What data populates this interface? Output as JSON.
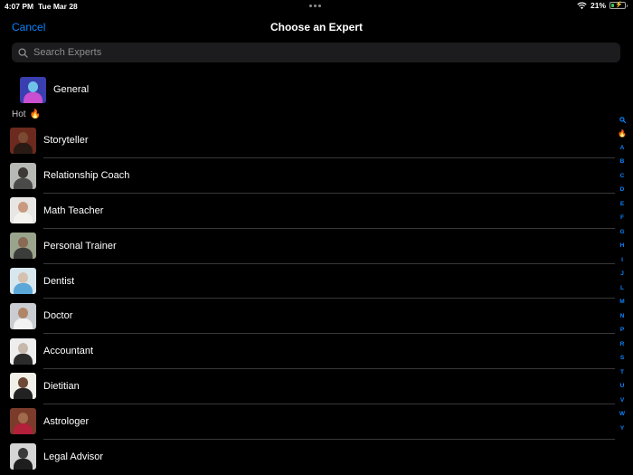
{
  "status_bar": {
    "time": "4:07 PM",
    "date": "Tue Mar 28",
    "battery_text": "21%",
    "battery_level": 0.21
  },
  "nav": {
    "cancel_label": "Cancel",
    "title": "Choose an Expert"
  },
  "search": {
    "placeholder": "Search Experts"
  },
  "general": {
    "label": "General"
  },
  "section": {
    "label": "Hot",
    "emoji": "🔥"
  },
  "experts": [
    {
      "label": "Storyteller",
      "bg": "#6b2a1d",
      "skin": "#7a4a32",
      "shirt": "#2a1a14"
    },
    {
      "label": "Relationship Coach",
      "bg": "#b7b9b4",
      "skin": "#3d3a36",
      "shirt": "#4a4a48"
    },
    {
      "label": "Math Teacher",
      "bg": "#e8e6e2",
      "skin": "#c99a80",
      "shirt": "#f4f2ee"
    },
    {
      "label": "Personal Trainer",
      "bg": "#9aa48c",
      "skin": "#8a6a55",
      "shirt": "#3b3d3a"
    },
    {
      "label": "Dentist",
      "bg": "#d8e6ee",
      "skin": "#d6c0b0",
      "shirt": "#5aa7d8"
    },
    {
      "label": "Doctor",
      "bg": "#c9cdd1",
      "skin": "#b08668",
      "shirt": "#f2f2f2"
    },
    {
      "label": "Accountant",
      "bg": "#eeeeee",
      "skin": "#c7b8ac",
      "shirt": "#2b2b2b"
    },
    {
      "label": "Dietitian",
      "bg": "#f2efe9",
      "skin": "#6e4a36",
      "shirt": "#222222"
    },
    {
      "label": "Astrologer",
      "bg": "#7a3b2a",
      "skin": "#a06a4c",
      "shirt": "#b2203a"
    },
    {
      "label": "Legal Advisor",
      "bg": "#d5d5d5",
      "skin": "#3a3a3a",
      "shirt": "#1e1e1e"
    }
  ],
  "general_avatar": {
    "bg": "#3a3fb0",
    "skin": "#6fc3e8",
    "shirt": "#c84fd0"
  },
  "index": [
    "A",
    "B",
    "C",
    "D",
    "E",
    "F",
    "G",
    "H",
    "I",
    "J",
    "L",
    "M",
    "N",
    "P",
    "R",
    "S",
    "T",
    "U",
    "V",
    "W",
    "Y"
  ]
}
